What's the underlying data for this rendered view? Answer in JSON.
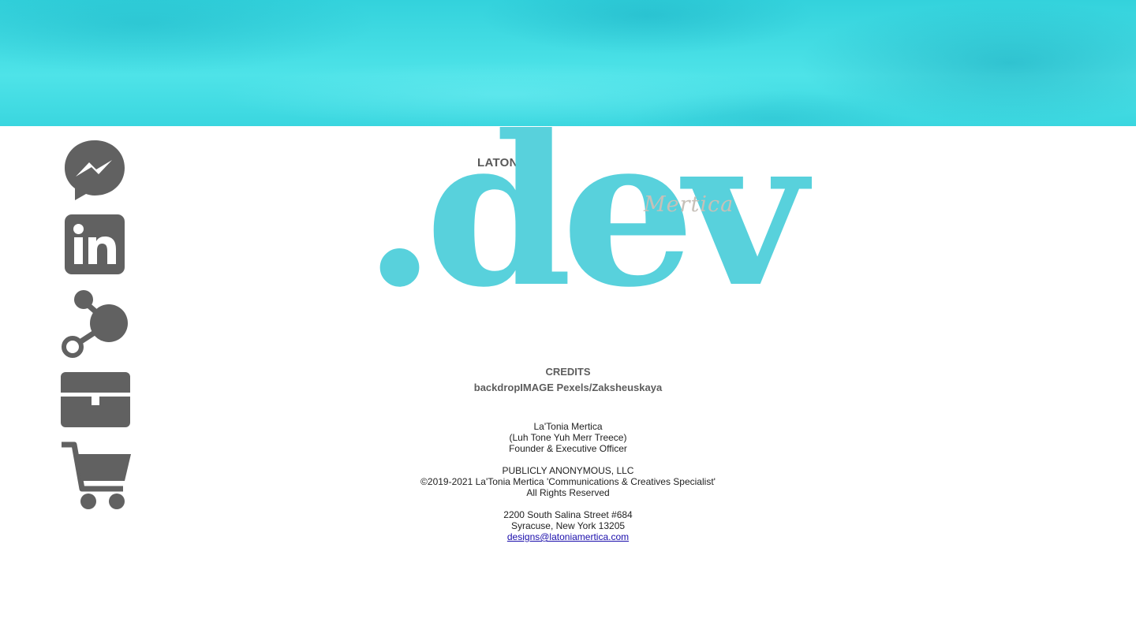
{
  "sidebar": {
    "icons": [
      {
        "name": "messenger-icon",
        "color": "#616161"
      },
      {
        "name": "linkedin-icon",
        "color": "#616161"
      },
      {
        "name": "share-icon",
        "color": "#616161"
      },
      {
        "name": "briefcase-icon",
        "color": "#616161"
      },
      {
        "name": "cart-icon",
        "color": "#616161"
      }
    ]
  },
  "logo": {
    "top_text": "LATONIA",
    "main_text": ".dev",
    "script_text": "Mertica",
    "accent_color": "#58d1dc"
  },
  "credits": {
    "heading": "CREDITS",
    "line": "backdropIMAGE Pexels/Zaksheuskaya"
  },
  "footer": {
    "name": "La'Tonia Mertica",
    "pronunciation": "(Luh Tone Yuh Merr Treece)",
    "title": "Founder & Executive Officer",
    "company": "PUBLICLY ANONYMOUS, LLC",
    "copyright": "©2019-2021 La'Tonia Mertica 'Communications & Creatives Specialist'",
    "rights": "All Rights Reserved",
    "address_line1": "2200 South Salina Street #684",
    "address_line2": "Syracuse, New York 13205",
    "email": "designs@latoniamertica.com"
  },
  "colors": {
    "hero": "#3ad6df",
    "icon_gray": "#616161",
    "text_gray": "#5d5d5d"
  }
}
